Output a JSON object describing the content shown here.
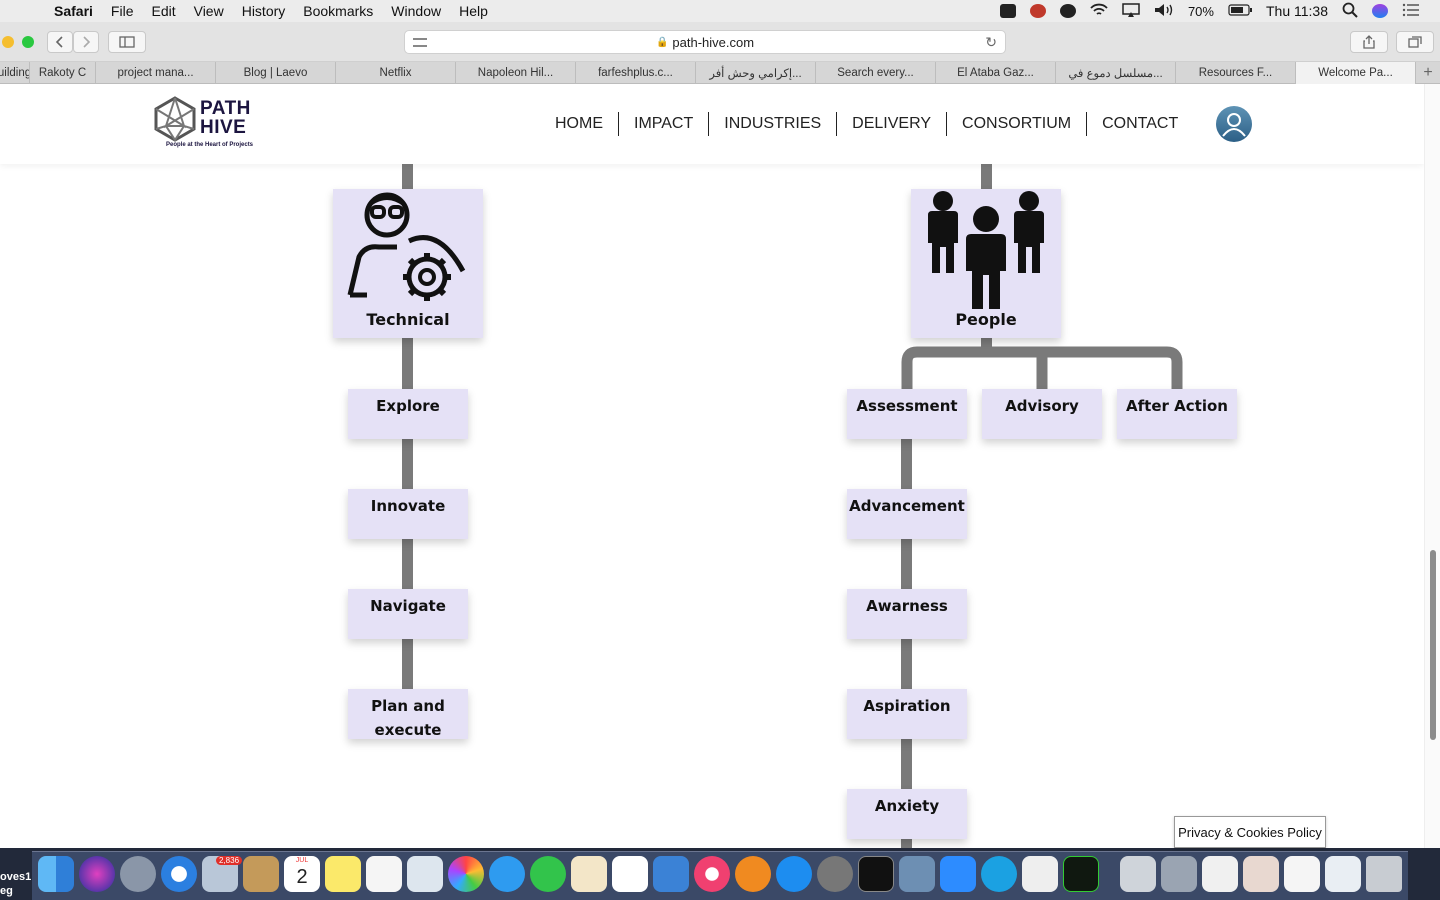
{
  "menubar": {
    "app": "Safari",
    "items": [
      "File",
      "Edit",
      "View",
      "History",
      "Bookmarks",
      "Window",
      "Help"
    ],
    "battery": "70%",
    "clock": "Thu 11:38"
  },
  "browser": {
    "url": "path-hive.com",
    "tabs": [
      "uilding",
      "Rakoty C",
      "project mana...",
      "Blog | Laevo",
      "Netflix",
      "Napoleon Hil...",
      "farfeshplus.c...",
      "إكرامي وحش أفر...",
      "Search every...",
      "El Ataba Gaz...",
      "مسلسل دموع في...",
      "Resources F...",
      "Welcome Pa..."
    ],
    "active_tab": "Welcome Pa..."
  },
  "site": {
    "logo_line1": "PATH",
    "logo_line2": "HIVE",
    "tagline": "People at the Heart of Projects",
    "nav": [
      "HOME",
      "IMPACT",
      "INDUSTRIES",
      "DELIVERY",
      "CONSORTIUM",
      "CONTACT"
    ]
  },
  "diagram": {
    "left_head": "Technical",
    "left_items": [
      "Explore",
      "Innovate",
      "Navigate",
      "Plan and execute"
    ],
    "right_head": "People",
    "right_branches": [
      "Assessment",
      "Advisory",
      "After Action"
    ],
    "right_items": [
      "Advancement",
      "Awarness",
      "Aspiration",
      "Anxiety"
    ]
  },
  "cookie_notice": "Privacy & Cookies Policy",
  "dock": {
    "mail_badge": "2,836",
    "calendar_month": "JUL",
    "calendar_day": "2",
    "desktop_label": [
      "oves1",
      "eg"
    ]
  }
}
